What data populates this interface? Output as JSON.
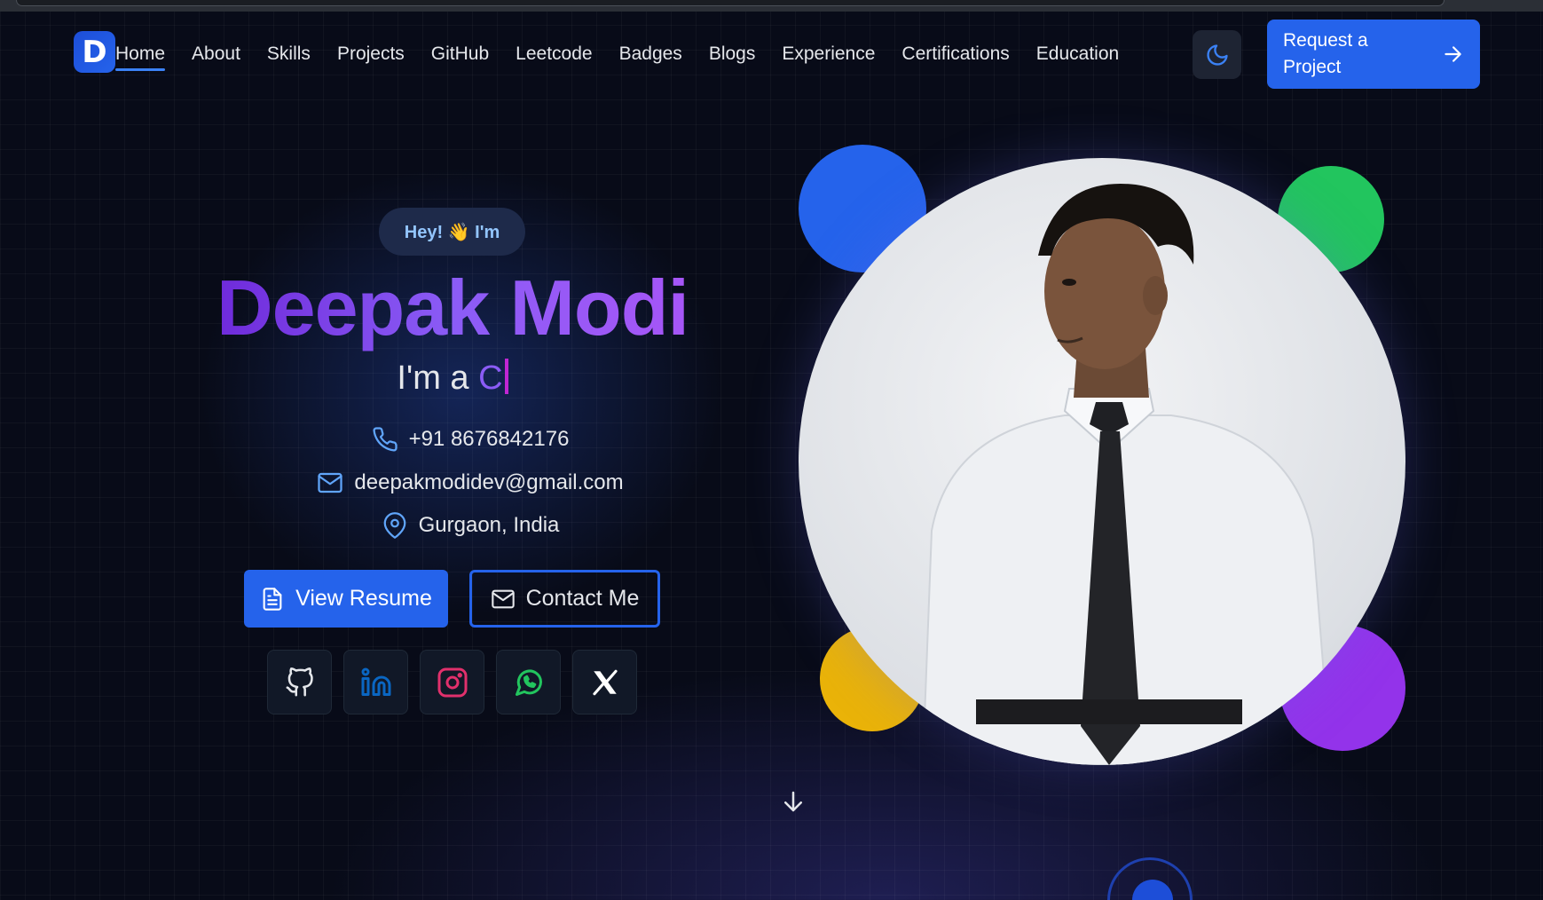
{
  "nav": {
    "logo_letter": "D",
    "links": [
      "Home",
      "About",
      "Skills",
      "Projects",
      "GitHub",
      "Leetcode",
      "Badges",
      "Blogs",
      "Experience",
      "Certifications",
      "Education"
    ],
    "active": "Home",
    "cta_label": "Request a Project",
    "theme_icon": "moon-icon"
  },
  "hero": {
    "greeting": "Hey! 👋 I'm",
    "name": "Deepak Modi",
    "role_prefix": "I'm a",
    "role_typed": "C",
    "phone": "+91 8676842176",
    "email": "deepakmodidev@gmail.com",
    "location": "Gurgaon, India",
    "primary_button": "View Resume",
    "secondary_button": "Contact Me",
    "socials": [
      "github-icon",
      "linkedin-icon",
      "instagram-icon",
      "whatsapp-icon",
      "x-icon"
    ]
  },
  "colors": {
    "accent": "#2563eb",
    "name_gradient_start": "#6d28d9",
    "name_gradient_end": "#a855f7",
    "blob_blue": "#2563eb",
    "blob_green": "#22c55e",
    "blob_yellow": "#eab308",
    "blob_purple": "#9333ea",
    "background": "#080b18"
  }
}
